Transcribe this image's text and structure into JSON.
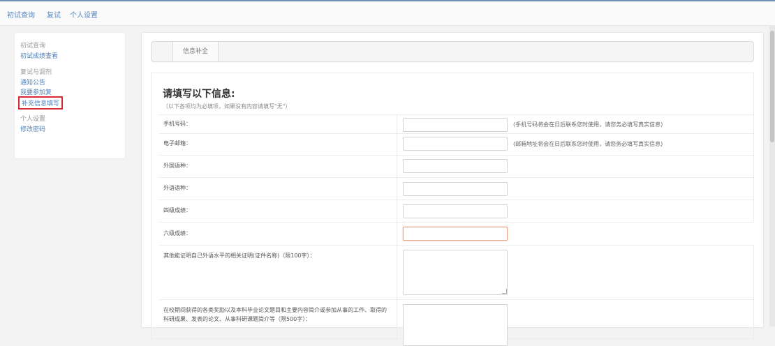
{
  "topnav": {
    "items": [
      "初试查询",
      "复试",
      "个人设置"
    ]
  },
  "sidebar": {
    "sections": [
      {
        "type": "head",
        "label": "初试查询"
      },
      {
        "type": "link",
        "label": "初试成绩查看"
      },
      {
        "type": "head",
        "label": "复试与调剂"
      },
      {
        "type": "link",
        "label": "通知公告"
      },
      {
        "type": "link",
        "label": "我要参加复"
      },
      {
        "type": "active",
        "label": "补充信息填写"
      },
      {
        "type": "head",
        "label": "个人设置"
      },
      {
        "type": "link",
        "label": "修改密码"
      }
    ]
  },
  "tabs": {
    "active": "信息补全"
  },
  "form": {
    "title": "请填写以下信息:",
    "note": "（以下各项均为必填项，如果没有内容请填写\"无\"）",
    "fields": [
      {
        "label": "手机号码：",
        "value": "",
        "hint": "(手机号码将会在日后联系您时使用，请您务必填写真实信息)"
      },
      {
        "label": "电子邮箱：",
        "value": "",
        "hint": "(邮箱地址将会在日后联系您时使用，请您务必填写真实信息)"
      },
      {
        "label": "外国语种：",
        "value": "",
        "hint": ""
      },
      {
        "label": "外语语种：",
        "value": "",
        "hint": ""
      },
      {
        "label": "四级成绩：",
        "value": "",
        "hint": ""
      },
      {
        "label": "六级成绩：",
        "value": "",
        "hint": ""
      }
    ],
    "textareas": [
      {
        "label": "其他能证明自己外语水平的相关证明(证件名称)（限100字）：",
        "value": ""
      },
      {
        "label": "在校期间获得的各类奖励以及本科毕业论文题目和主要内容简介或参加从事的工作、取得的科研成果、发表的论文、从事科研课题简介等（限500字）：",
        "value": ""
      }
    ]
  },
  "colors": {
    "accent": "#4f7fb7",
    "highlight_border": "#d62b35",
    "topbar": "#6f8fb4"
  }
}
